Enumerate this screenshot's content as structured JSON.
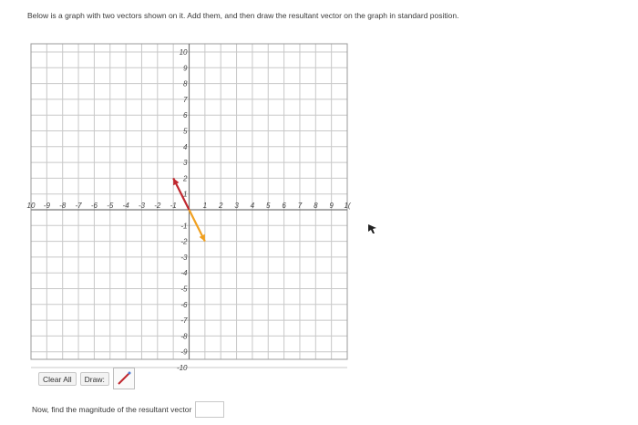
{
  "instructions": {
    "text": "Below is a graph with two vectors shown on it. Add them, and then draw the resultant vector on the graph in standard position."
  },
  "graph": {
    "x_ticks": [
      "10",
      "-9",
      "-8",
      "-7",
      "-6",
      "-5",
      "-4",
      "-3",
      "-2",
      "-1",
      "1",
      "2",
      "3",
      "4",
      "5",
      "6",
      "7",
      "8",
      "9",
      "1("
    ],
    "y_ticks_positive": [
      "10",
      "9",
      "8",
      "7",
      "6",
      "5",
      "4",
      "3",
      "2",
      "1"
    ],
    "y_ticks_negative": [
      "-1",
      "-2",
      "-3",
      "-4",
      "-5",
      "-6",
      "-7",
      "-8",
      "-9",
      "-10"
    ],
    "vectors": [
      {
        "name": "vector-a",
        "from": [
          0,
          0
        ],
        "to": [
          -1,
          2
        ],
        "color": "#c0282f"
      },
      {
        "name": "vector-b",
        "from": [
          0,
          0
        ],
        "to": [
          1,
          -2
        ],
        "color": "#f0a020"
      }
    ],
    "grid_color": "#c8c8c8",
    "axis_color": "#777777"
  },
  "toolbar": {
    "clear_label": "Clear All",
    "draw_label": "Draw:",
    "tool_icon": "pencil-line-icon"
  },
  "magnitude": {
    "label": "Now, find the magnitude of the resultant vector",
    "value": ""
  }
}
